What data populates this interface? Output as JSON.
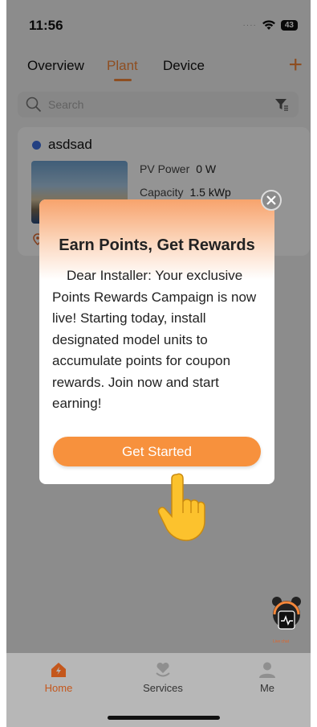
{
  "status_bar": {
    "time": "11:56",
    "battery": "43"
  },
  "tabs": [
    {
      "label": "Overview",
      "active": false
    },
    {
      "label": "Plant",
      "active": true
    },
    {
      "label": "Device",
      "active": false
    }
  ],
  "search": {
    "placeholder": "Search"
  },
  "plant_card": {
    "name": "asdsad",
    "status_color": "#3d6fe0",
    "pv_power_label": "PV Power",
    "pv_power_value": "0 W",
    "capacity_label": "Capacity",
    "capacity_value": "1.5 kWp"
  },
  "modal": {
    "title": "Earn Points, Get Rewards",
    "body": "Dear Installer: Your exclusive Points Rewards Campaign is now live! Starting today, install designated model units to accumulate points for coupon rewards. Join now and start earning!",
    "cta_label": "Get Started"
  },
  "helper": {
    "label": "Live chat"
  },
  "bottom_nav": [
    {
      "label": "Home",
      "icon": "home-icon",
      "active": true
    },
    {
      "label": "Services",
      "icon": "services-icon",
      "active": false
    },
    {
      "label": "Me",
      "icon": "profile-icon",
      "active": false
    }
  ],
  "colors": {
    "accent": "#f5873a",
    "cta": "#f7913d"
  }
}
